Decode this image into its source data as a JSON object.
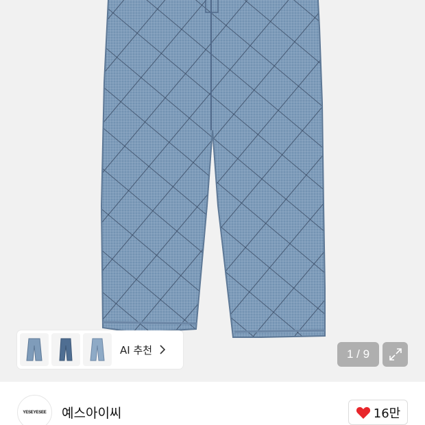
{
  "product": {
    "image_alt": "quilted diamond stitch wide denim pants",
    "image_counter": "1 / 9"
  },
  "ai_recommend": {
    "label": "AI 추천",
    "thumbnails": [
      "jeans-thumb-1",
      "jeans-thumb-2",
      "jeans-thumb-3"
    ]
  },
  "brand": {
    "logo_text": "YESEYESEE",
    "name": "예스아이씨"
  },
  "like": {
    "count": "16만",
    "icon": "heart-icon",
    "color": "#e8262b"
  },
  "colors": {
    "denim": "#7a97b4",
    "stitch": "#2b3a52",
    "background": "#f1f1f1"
  }
}
